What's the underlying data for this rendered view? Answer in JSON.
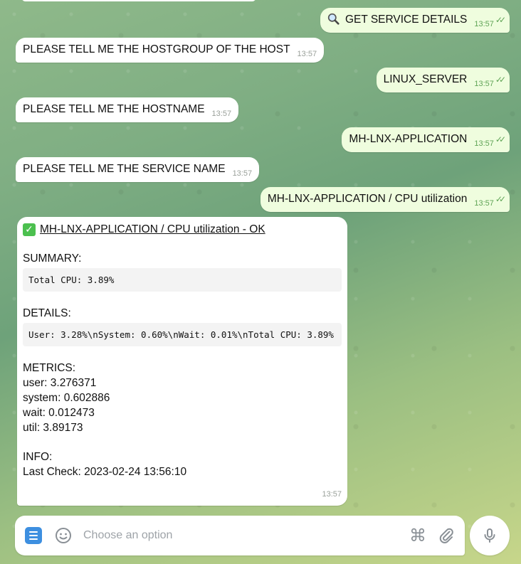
{
  "messages": [
    {
      "dir": "out",
      "icon": "magnifier-icon",
      "text": "GET SERVICE DETAILS",
      "time": "13:57"
    },
    {
      "dir": "in",
      "text": "PLEASE TELL ME THE HOSTGROUP OF THE HOST",
      "time": "13:57"
    },
    {
      "dir": "out",
      "text": "LINUX_SERVER",
      "time": "13:57"
    },
    {
      "dir": "in",
      "text": "PLEASE TELL ME THE HOSTNAME",
      "time": "13:57"
    },
    {
      "dir": "out",
      "text": "MH-LNX-APPLICATION",
      "time": "13:57"
    },
    {
      "dir": "in",
      "text": "PLEASE TELL ME THE SERVICE NAME",
      "time": "13:57"
    },
    {
      "dir": "out",
      "text": "MH-LNX-APPLICATION / CPU utilization",
      "time": "13:57"
    }
  ],
  "ticks": "✓✓",
  "card": {
    "title": "MH-LNX-APPLICATION / CPU utilization - OK",
    "summary_label": "SUMMARY:",
    "summary_code": "Total CPU: 3.89%",
    "details_label": "DETAILS:",
    "details_code": "User: 3.28%\\nSystem: 0.60%\\nWait: 0.01%\\nTotal CPU: 3.89%",
    "metrics_label": "METRICS:",
    "metrics": [
      "user: 3.276371",
      "system: 0.602886",
      "wait: 0.012473",
      "util: 3.89173"
    ],
    "info_label": "INFO:",
    "last_check": "Last Check: 2023-02-24 13:56:10",
    "time": "13:57"
  },
  "composer": {
    "placeholder": "Choose an option",
    "command_glyph": "⌘"
  },
  "colors": {
    "incoming": "#ffffff",
    "outgoing": "#effdde",
    "accent": "#3d8fe0",
    "check": "#4cc04f"
  }
}
